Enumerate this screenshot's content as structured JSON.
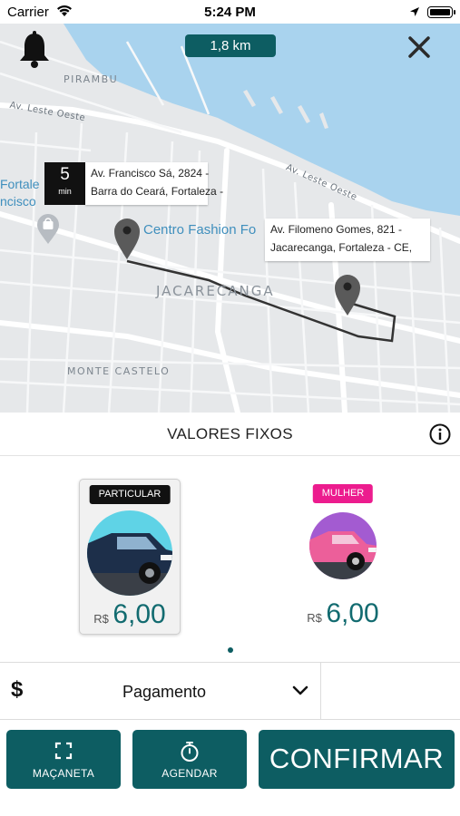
{
  "status_bar": {
    "carrier": "Carrier",
    "time": "5:24 PM"
  },
  "map": {
    "distance": "1,8 km",
    "labels": {
      "pirambu": "PIRAMBU",
      "av_leste_oeste_1": "Av. Leste Oeste",
      "av_leste_oeste_2": "Av. Leste Oeste",
      "jacarecanga": "JACARECANGA",
      "monte_castelo": "MONTE CASTELO",
      "centro_fashion": "Centro Fashion Fo",
      "fortale_line1": "Fortale",
      "fortale_line2": "ncisco"
    },
    "eta": {
      "value": "5",
      "unit": "min"
    },
    "origin_address": {
      "line1": "Av. Francisco Sá, 2824 -",
      "line2": "Barra do Ceará, Fortaleza -"
    },
    "destination_address": {
      "line1": "Av. Filomeno Gomes, 821 -",
      "line2": "Jacarecanga, Fortaleza - CE,"
    },
    "colors": {
      "water": "#a9d3ee",
      "land": "#e6e8ea",
      "road": "#ffffff",
      "route": "#333333"
    }
  },
  "fixed_values": {
    "title": "VALORES FIXOS"
  },
  "options": [
    {
      "badge": "PARTICULAR",
      "currency": "R$",
      "price": "6,00",
      "selected": true,
      "badge_color": "#111111",
      "circle_color": "#5fd3e6"
    },
    {
      "badge": "MULHER",
      "currency": "R$",
      "price": "6,00",
      "selected": false,
      "badge_color": "#ec1c8e",
      "circle_color": "#a35bd1"
    }
  ],
  "payment": {
    "symbol": "$",
    "label": "Pagamento"
  },
  "buttons": {
    "macaneta": "MAÇANETA",
    "agendar": "AGENDAR",
    "confirm": "CONFIRMAR"
  },
  "accent_color": "#0d5d62"
}
